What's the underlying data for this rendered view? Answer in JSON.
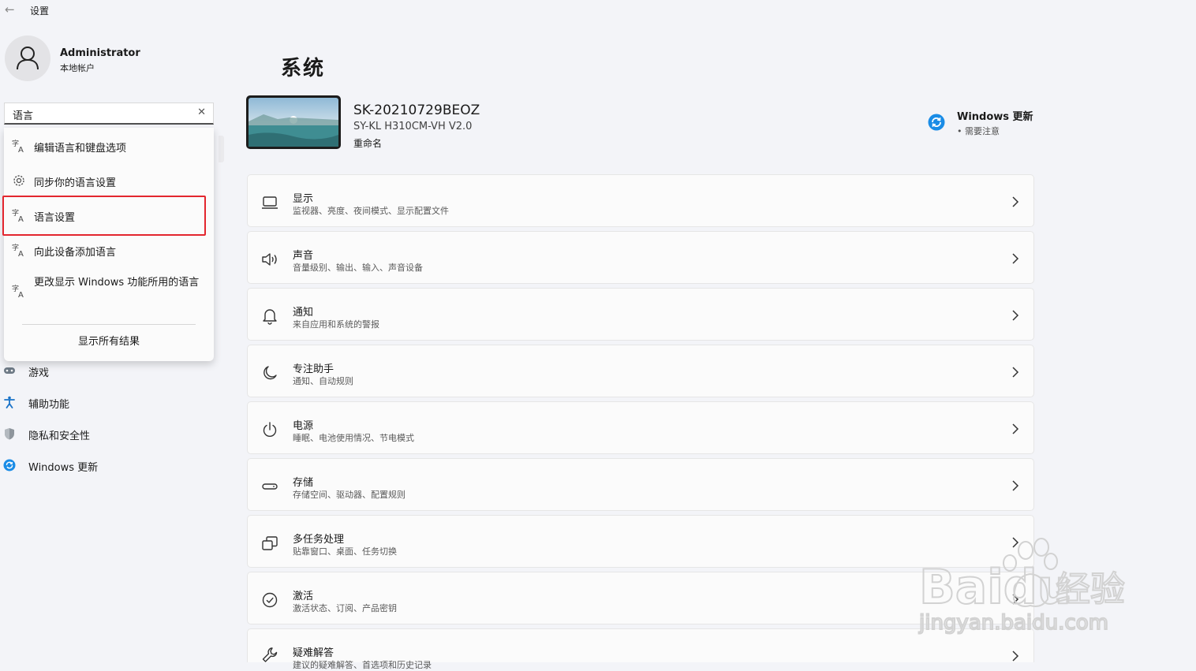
{
  "window": {
    "title": "设置"
  },
  "profile": {
    "name": "Administrator",
    "account_type": "本地帐户"
  },
  "search": {
    "value": "语言",
    "results": [
      {
        "label": "编辑语言和键盘选项",
        "icon": "language-icon"
      },
      {
        "label": "同步你的语言设置",
        "icon": "gear-icon"
      },
      {
        "label": "语言设置",
        "icon": "language-icon",
        "highlighted": true
      },
      {
        "label": "向此设备添加语言",
        "icon": "language-icon"
      },
      {
        "label": "更改显示 Windows 功能所用的语言",
        "icon": "language-icon"
      }
    ],
    "show_all": "显示所有结果"
  },
  "sidebar": {
    "items": [
      {
        "label": "游戏",
        "icon": "gamepad-icon"
      },
      {
        "label": "辅助功能",
        "icon": "accessibility-icon"
      },
      {
        "label": "隐私和安全性",
        "icon": "shield-icon"
      },
      {
        "label": "Windows 更新",
        "icon": "update-icon"
      }
    ]
  },
  "main": {
    "title": "系统",
    "device": {
      "name": "SK-20210729BEOZ",
      "model": "SY-KL H310CM-VH V2.0",
      "rename": "重命名"
    },
    "windows_update": {
      "title": "Windows 更新",
      "status": "• 需要注意"
    },
    "cards": [
      {
        "title": "显示",
        "subtitle": "监视器、亮度、夜间模式、显示配置文件",
        "icon": "monitor-icon"
      },
      {
        "title": "声音",
        "subtitle": "音量级别、输出、输入、声音设备",
        "icon": "speaker-icon"
      },
      {
        "title": "通知",
        "subtitle": "来自应用和系统的警报",
        "icon": "bell-icon"
      },
      {
        "title": "专注助手",
        "subtitle": "通知、自动规则",
        "icon": "moon-icon"
      },
      {
        "title": "电源",
        "subtitle": "睡眠、电池使用情况、节电模式",
        "icon": "power-icon"
      },
      {
        "title": "存储",
        "subtitle": "存储空间、驱动器、配置规则",
        "icon": "storage-icon"
      },
      {
        "title": "多任务处理",
        "subtitle": "贴靠窗口、桌面、任务切换",
        "icon": "multitask-icon"
      },
      {
        "title": "激活",
        "subtitle": "激活状态、订阅、产品密钥",
        "icon": "check-circle-icon"
      },
      {
        "title": "疑难解答",
        "subtitle": "建议的疑难解答、首选项和历史记录",
        "icon": "wrench-icon"
      }
    ]
  },
  "watermark": {
    "brand": "Baidu",
    "suffix": "经验",
    "url": "jingyan.baidu.com"
  },
  "colors": {
    "accent": "#0067c0",
    "highlight_border": "#e3262e",
    "update_blue": "#1a8ce6"
  }
}
